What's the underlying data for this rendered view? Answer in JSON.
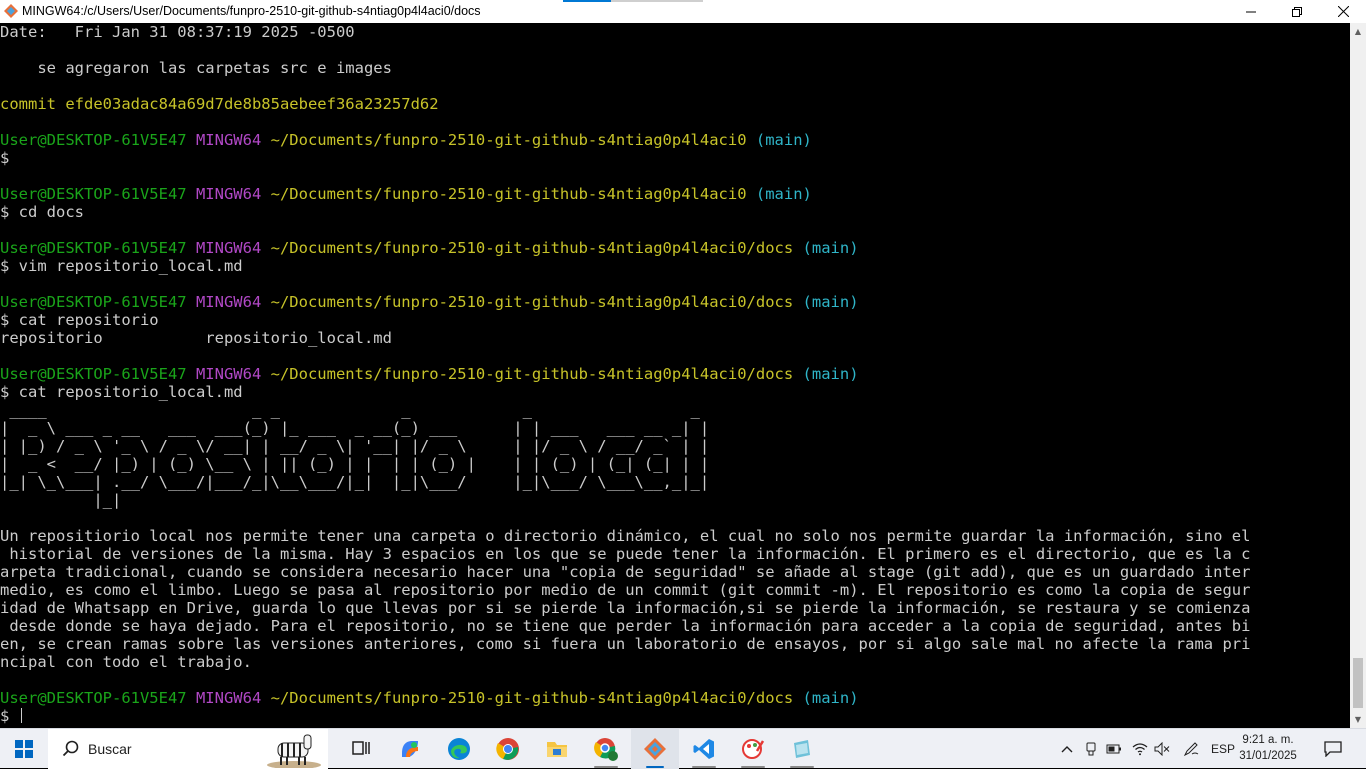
{
  "window": {
    "title": "MINGW64:/c/Users/User/Documents/funpro-2510-git-github-s4ntiag0p4l4aci0/docs",
    "minimize": "—",
    "maximize": "❐",
    "close": "✕"
  },
  "terminal": {
    "lines": [
      [
        [
          "w",
          "Date:   Fri Jan 31 08:37:19 2025 -0500"
        ]
      ],
      [],
      [
        [
          "w",
          "    se agregaron las carpetas src e images"
        ]
      ],
      [],
      [
        [
          "y",
          "commit efde03adac84a69d7de8b85aebeef36a23257d62"
        ]
      ],
      [],
      [
        [
          "g",
          "User@DESKTOP-61V5E47 "
        ],
        [
          "m",
          "MINGW64 "
        ],
        [
          "y",
          "~/Documents/funpro-2510-git-github-s4ntiag0p4l4aci0 "
        ],
        [
          "c",
          "(main)"
        ]
      ],
      [
        [
          "w",
          "$"
        ]
      ],
      [],
      [
        [
          "g",
          "User@DESKTOP-61V5E47 "
        ],
        [
          "m",
          "MINGW64 "
        ],
        [
          "y",
          "~/Documents/funpro-2510-git-github-s4ntiag0p4l4aci0 "
        ],
        [
          "c",
          "(main)"
        ]
      ],
      [
        [
          "w",
          "$ cd docs"
        ]
      ],
      [],
      [
        [
          "g",
          "User@DESKTOP-61V5E47 "
        ],
        [
          "m",
          "MINGW64 "
        ],
        [
          "y",
          "~/Documents/funpro-2510-git-github-s4ntiag0p4l4aci0/docs "
        ],
        [
          "c",
          "(main)"
        ]
      ],
      [
        [
          "w",
          "$ vim repositorio_local.md"
        ]
      ],
      [],
      [
        [
          "g",
          "User@DESKTOP-61V5E47 "
        ],
        [
          "m",
          "MINGW64 "
        ],
        [
          "y",
          "~/Documents/funpro-2510-git-github-s4ntiag0p4l4aci0/docs "
        ],
        [
          "c",
          "(main)"
        ]
      ],
      [
        [
          "w",
          "$ cat repositorio"
        ]
      ],
      [
        [
          "w",
          "repositorio           repositorio_local.md"
        ]
      ],
      [],
      [
        [
          "g",
          "User@DESKTOP-61V5E47 "
        ],
        [
          "m",
          "MINGW64 "
        ],
        [
          "y",
          "~/Documents/funpro-2510-git-github-s4ntiag0p4l4aci0/docs "
        ],
        [
          "c",
          "(main)"
        ]
      ],
      [
        [
          "w",
          "$ cat repositorio_local.md"
        ]
      ],
      [
        [
          "w",
          " ____                      _ _             _            _                 _ "
        ]
      ],
      [
        [
          "w",
          "|  _ \\ ___ _ __   ___  ___(_) |_ ___  _ __(_) ___      | | ___   ___ __ _| |"
        ]
      ],
      [
        [
          "w",
          "| |_) / _ \\ '_ \\ / _ \\/ __| | __/ _ \\| '__| |/ _ \\     | |/ _ \\ / __/ _` | |"
        ]
      ],
      [
        [
          "w",
          "|  _ <  __/ |_) | (_) \\__ \\ | || (_) | |  | | (_) |    | | (_) | (_| (_| | |"
        ]
      ],
      [
        [
          "w",
          "|_| \\_\\___| .__/ \\___/|___/_|\\__\\___/|_|  |_|\\___/     |_|\\___/ \\___\\__,_|_|"
        ]
      ],
      [
        [
          "w",
          "          |_|"
        ]
      ],
      [],
      [
        [
          "w",
          "Un repositiorio local nos permite tener una carpeta o directorio dinámico, el cual no solo nos permite guardar la información, sino el"
        ]
      ],
      [
        [
          "w",
          " historial de versiones de la misma. Hay 3 espacios en los que se puede tener la información. El primero es el directorio, que es la c"
        ]
      ],
      [
        [
          "w",
          "arpeta tradicional, cuando se considera necesario hacer una \"copia de seguridad\" se añade al stage (git add), que es un guardado inter"
        ]
      ],
      [
        [
          "w",
          "medio, es como el limbo. Luego se pasa al repositorio por medio de un commit (git commit -m). El repositorio es como la copia de segur"
        ]
      ],
      [
        [
          "w",
          "idad de Whatsapp en Drive, guarda lo que llevas por si se pierde la información,si se pierde la información, se restaura y se comienza"
        ]
      ],
      [
        [
          "w",
          " desde donde se haya dejado. Para el repositorio, no se tiene que perder la información para acceder a la copia de seguridad, antes bi"
        ]
      ],
      [
        [
          "w",
          "en, se crean ramas sobre las versiones anteriores, como si fuera un laboratorio de ensayos, por si algo sale mal no afecte la rama pri"
        ]
      ],
      [
        [
          "w",
          "ncipal con todo el trabajo."
        ]
      ],
      [],
      [
        [
          "g",
          "User@DESKTOP-61V5E47 "
        ],
        [
          "m",
          "MINGW64 "
        ],
        [
          "y",
          "~/Documents/funpro-2510-git-github-s4ntiag0p4l4aci0/docs "
        ],
        [
          "c",
          "(main)"
        ]
      ],
      [
        [
          "w",
          "$ "
        ]
      ]
    ]
  },
  "taskbar": {
    "search_label": "Buscar",
    "pinned": [
      "task-view-icon",
      "copilot-icon",
      "edge-icon",
      "chrome-icon",
      "file-explorer-icon",
      "chrome-profile-icon",
      "git-gui-icon",
      "vscode-icon",
      "paint-icon",
      "notepad-icon"
    ],
    "tray": {
      "language": "ESP",
      "time": "9:21 a. m.",
      "date": "31/01/2025"
    }
  },
  "colors": {
    "prompt_user": "#1aa51a",
    "prompt_host": "#b148c6",
    "prompt_path": "#c7c329",
    "prompt_branch": "#2fb5c8",
    "text": "#cccccc"
  }
}
